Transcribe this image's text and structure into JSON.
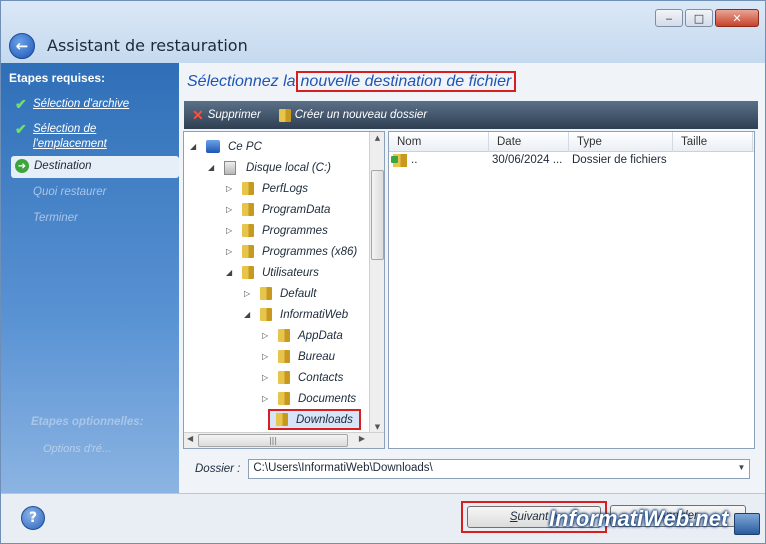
{
  "window": {
    "title": "Assistant de restauration",
    "controls": [
      "‒",
      "□",
      "✕"
    ]
  },
  "sidebar": {
    "required_header": "Etapes requises:",
    "items": [
      {
        "label": "Sélection d'archive",
        "state": "done"
      },
      {
        "label": "Sélection de l'emplacement",
        "state": "done"
      },
      {
        "label": "Destination",
        "state": "current"
      },
      {
        "label": "Quoi restaurer",
        "state": "disabled"
      },
      {
        "label": "Terminer",
        "state": "disabled"
      }
    ],
    "optional_header": "Etapes optionnelles:",
    "optional_items": [
      {
        "label": "Options d'ré..."
      }
    ]
  },
  "main": {
    "title_prefix": "Sélectionnez la",
    "title_highlight": "nouvelle destination de fichier",
    "toolbar": {
      "delete_label": "Supprimer",
      "new_folder_label": "Créer un nouveau dossier"
    },
    "tree": [
      {
        "label": "Ce PC",
        "level": 0,
        "expanded": true,
        "icon": "computer-icon"
      },
      {
        "label": "Disque local (C:)",
        "level": 1,
        "expanded": true,
        "icon": "disk-icon"
      },
      {
        "label": "PerfLogs",
        "level": 2,
        "expanded": false,
        "icon": "folder-icon"
      },
      {
        "label": "ProgramData",
        "level": 2,
        "expanded": false,
        "icon": "folder-icon"
      },
      {
        "label": "Programmes",
        "level": 2,
        "expanded": false,
        "icon": "folder-icon"
      },
      {
        "label": "Programmes (x86)",
        "level": 2,
        "expanded": false,
        "icon": "folder-icon"
      },
      {
        "label": "Utilisateurs",
        "level": 2,
        "expanded": true,
        "icon": "folder-icon"
      },
      {
        "label": "Default",
        "level": 3,
        "expanded": false,
        "icon": "folder-icon"
      },
      {
        "label": "InformatiWeb",
        "level": 3,
        "expanded": true,
        "icon": "folder-icon"
      },
      {
        "label": "AppData",
        "level": 4,
        "expanded": false,
        "icon": "folder-icon"
      },
      {
        "label": "Bureau",
        "level": 4,
        "expanded": false,
        "icon": "folder-icon"
      },
      {
        "label": "Contacts",
        "level": 4,
        "expanded": false,
        "icon": "folder-icon"
      },
      {
        "label": "Documents",
        "level": 4,
        "expanded": false,
        "icon": "folder-icon"
      },
      {
        "label": "Downloads",
        "level": 4,
        "expanded": false,
        "icon": "folder-icon",
        "selected": true
      }
    ],
    "list": {
      "columns": [
        "Nom",
        "Date",
        "Type",
        "Taille"
      ],
      "rows": [
        {
          "name": "..",
          "date": "30/06/2024 ...",
          "type": "Dossier de fichiers",
          "size": ""
        }
      ]
    },
    "folder_label": "Dossier :",
    "folder_value": "C:\\Users\\InformatiWeb\\Downloads\\"
  },
  "footer": {
    "help_label": "?",
    "next_label_mnemonic": "S",
    "next_label_rest": "uivant >",
    "cancel_label": "Annuler"
  },
  "watermark": "InformatiWeb.net"
}
